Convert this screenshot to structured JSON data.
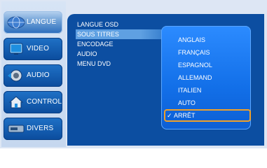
{
  "sidebar": {
    "items": [
      {
        "label": "LANGUE",
        "icon": "globe-icon",
        "active": true
      },
      {
        "label": "VIDEO",
        "icon": "tv-icon",
        "active": false
      },
      {
        "label": "AUDIO",
        "icon": "speaker-icon",
        "active": false
      },
      {
        "label": "CONTROL",
        "icon": "house-icon",
        "active": false
      },
      {
        "label": "DIVERS",
        "icon": "device-icon",
        "active": false
      }
    ]
  },
  "menu": {
    "items": [
      {
        "label": "LANGUE OSD"
      },
      {
        "label": "SOUS TITRES",
        "selected": true
      },
      {
        "label": "ENCODAGE"
      },
      {
        "label": "AUDIO"
      },
      {
        "label": "MENU DVD"
      }
    ]
  },
  "submenu": {
    "items": [
      {
        "label": "ANGLAIS"
      },
      {
        "label": "FRANÇAIS"
      },
      {
        "label": "ESPAGNOL"
      },
      {
        "label": "ALLEMAND"
      },
      {
        "label": "ITALIEN"
      },
      {
        "label": "AUTO"
      },
      {
        "label": "ARRÊT",
        "checked": true
      }
    ],
    "check_mark": "✓"
  },
  "colors": {
    "panel_blue": "#0c4ea1",
    "selected_row": "#5fa0e2",
    "submenu_blue": "#1a78f0",
    "highlight_orange": "#f0a029"
  }
}
